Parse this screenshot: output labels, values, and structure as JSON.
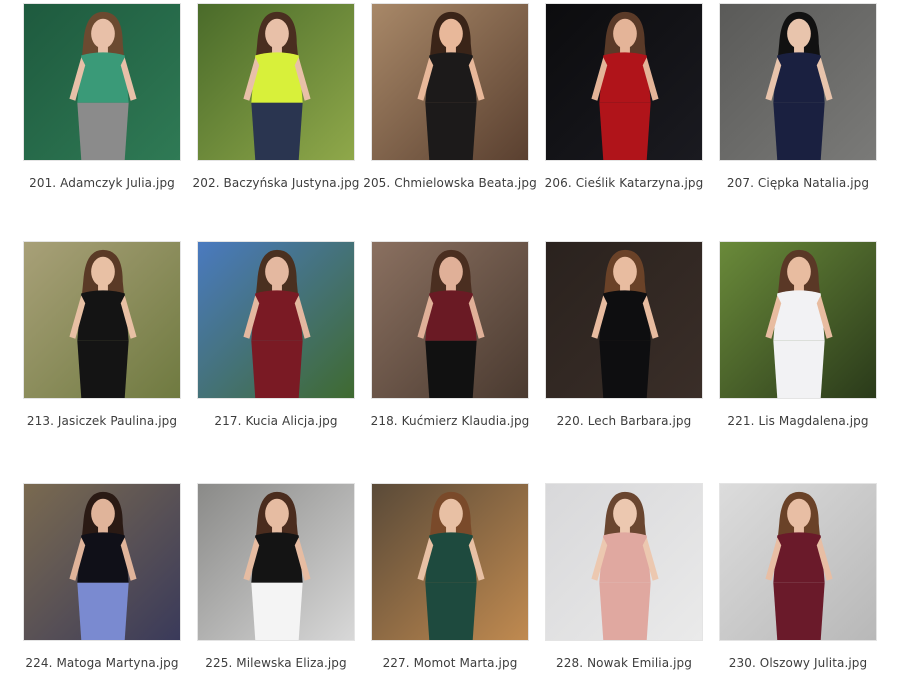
{
  "files": [
    {
      "name": "201. Adamczyk Julia.jpg",
      "bg": "#1e5a3e",
      "bg2": "#2f7a55",
      "figure": "#3a9a78",
      "skin": "#e8c0a8",
      "hair": "#6b4a30",
      "lower": "#8b8b8b"
    },
    {
      "name": "202. Baczyńska Justyna.jpg",
      "bg": "#4a6b2a",
      "bg2": "#8fa84a",
      "figure": "#d8f03a",
      "skin": "#e8c0a8",
      "hair": "#4a2e20",
      "lower": "#2a3550"
    },
    {
      "name": "205. Chmielowska Beata.jpg",
      "bg": "#a88868",
      "bg2": "#5a4030",
      "figure": "#1c1a1a",
      "skin": "#e8b89a",
      "hair": "#3a2418",
      "lower": "#1c1a1a"
    },
    {
      "name": "206. Cieślik Katarzyna.jpg",
      "bg": "#0c0c0e",
      "bg2": "#1a1a20",
      "figure": "#b0141a",
      "skin": "#e4b498",
      "hair": "#5a3a28",
      "lower": "#b0141a"
    },
    {
      "name": "207. Cięрka Natalia.jpg",
      "bg": "#5a5a58",
      "bg2": "#7a7a78",
      "figure": "#1a2040",
      "skin": "#e8c4ac",
      "hair": "#111111",
      "lower": "#1a2040"
    },
    {
      "name": "213. Jasiczek Paulina.jpg",
      "bg": "#a8a078",
      "bg2": "#6f7a40",
      "figure": "#141414",
      "skin": "#e8c0a4",
      "hair": "#5a3a26",
      "lower": "#141414"
    },
    {
      "name": "217. Kucia Alicja.jpg",
      "bg": "#4a7ac0",
      "bg2": "#3f6a30",
      "figure": "#7a1a24",
      "skin": "#e4b8a0",
      "hair": "#4a3020",
      "lower": "#7a1a24"
    },
    {
      "name": "218. Kućmierz Klaudia.jpg",
      "bg": "#8a7060",
      "bg2": "#4a3a30",
      "figure": "#6a1a24",
      "skin": "#e0b098",
      "hair": "#4a2e20",
      "lower": "#111111"
    },
    {
      "name": "220. Lech Barbara.jpg",
      "bg": "#2a221e",
      "bg2": "#3a2e28",
      "figure": "#0e0e10",
      "skin": "#e8bca0",
      "hair": "#6a4228",
      "lower": "#0e0e10"
    },
    {
      "name": "221. Lis Magdalena.jpg",
      "bg": "#6a8a3a",
      "bg2": "#2a3a1a",
      "figure": "#f2f2f4",
      "skin": "#e8bca0",
      "hair": "#5a3826",
      "lower": "#f2f2f4"
    },
    {
      "name": "224. Matoga Martyna.jpg",
      "bg": "#7a6a50",
      "bg2": "#3a3a5a",
      "figure": "#101018",
      "skin": "#e0b49a",
      "hair": "#2a1a14",
      "lower": "#7a8ad0"
    },
    {
      "name": "225. Milewska Eliza.jpg",
      "bg": "#8a8a88",
      "bg2": "#d8d8d8",
      "figure": "#141414",
      "skin": "#e6bca2",
      "hair": "#4a2c1e",
      "lower": "#f4f4f4"
    },
    {
      "name": "227. Momot Marta.jpg",
      "bg": "#5a4a38",
      "bg2": "#c08a50",
      "figure": "#1e4a3e",
      "skin": "#e8c0a4",
      "hair": "#7a4a2a",
      "lower": "#1e4a3e"
    },
    {
      "name": "228. Nowak Emilia.jpg",
      "bg": "#d8d8da",
      "bg2": "#eaeaea",
      "figure": "#e0a8a0",
      "skin": "#ecc8b0",
      "hair": "#6a4630",
      "lower": "#e0a8a0"
    },
    {
      "name": "230. Olszowy Julita.jpg",
      "bg": "#dcdcdc",
      "bg2": "#b8b8b8",
      "figure": "#6a1a2a",
      "skin": "#e8bea4",
      "hair": "#6a4228",
      "lower": "#6a1a2a"
    }
  ]
}
